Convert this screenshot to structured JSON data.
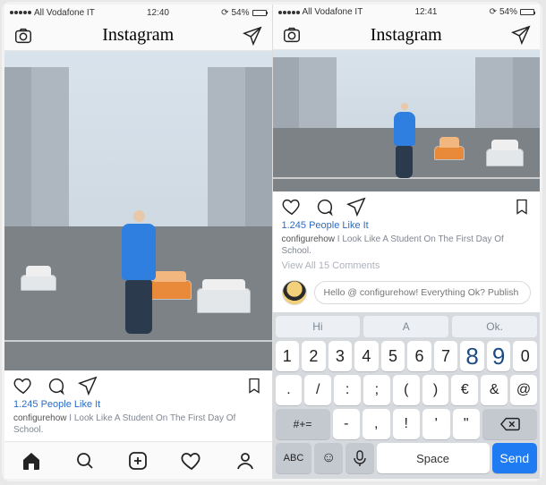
{
  "left": {
    "status": {
      "carrier": "All Vodafone IT",
      "time": "12:40",
      "battery": "54%"
    },
    "brand": "Instagram",
    "likes": "1.245 People Like It",
    "caption_user": "configurehow",
    "caption_text": " I Look Like A Student On The First Day Of School."
  },
  "right": {
    "status": {
      "carrier": "All Vodafone IT",
      "time": "12:41",
      "battery": "54%"
    },
    "brand": "Instagram",
    "likes": "1.245 People Like It",
    "caption_user": "configurehow",
    "caption_text": " I Look Like A Student On The First Day Of School.",
    "view_comments": "View All 15 Comments",
    "compose_placeholder": "Hello @ configurehow! Everything Ok? Publish",
    "keyboard": {
      "suggestions": [
        "Hi",
        "A",
        "Ok."
      ],
      "row_numbers": [
        "1",
        "2",
        "3",
        "4",
        "5",
        "6",
        "7",
        "8",
        "9",
        "0"
      ],
      "row_sym1": [
        ".",
        "/",
        ":",
        ";",
        "(",
        ")",
        "€",
        "&",
        "@"
      ],
      "row_sym2": [
        "-",
        ",",
        "!",
        "'",
        "\""
      ],
      "sym_toggle": "#+=",
      "abc": "ABC",
      "space": "Space",
      "send": "Send"
    }
  }
}
